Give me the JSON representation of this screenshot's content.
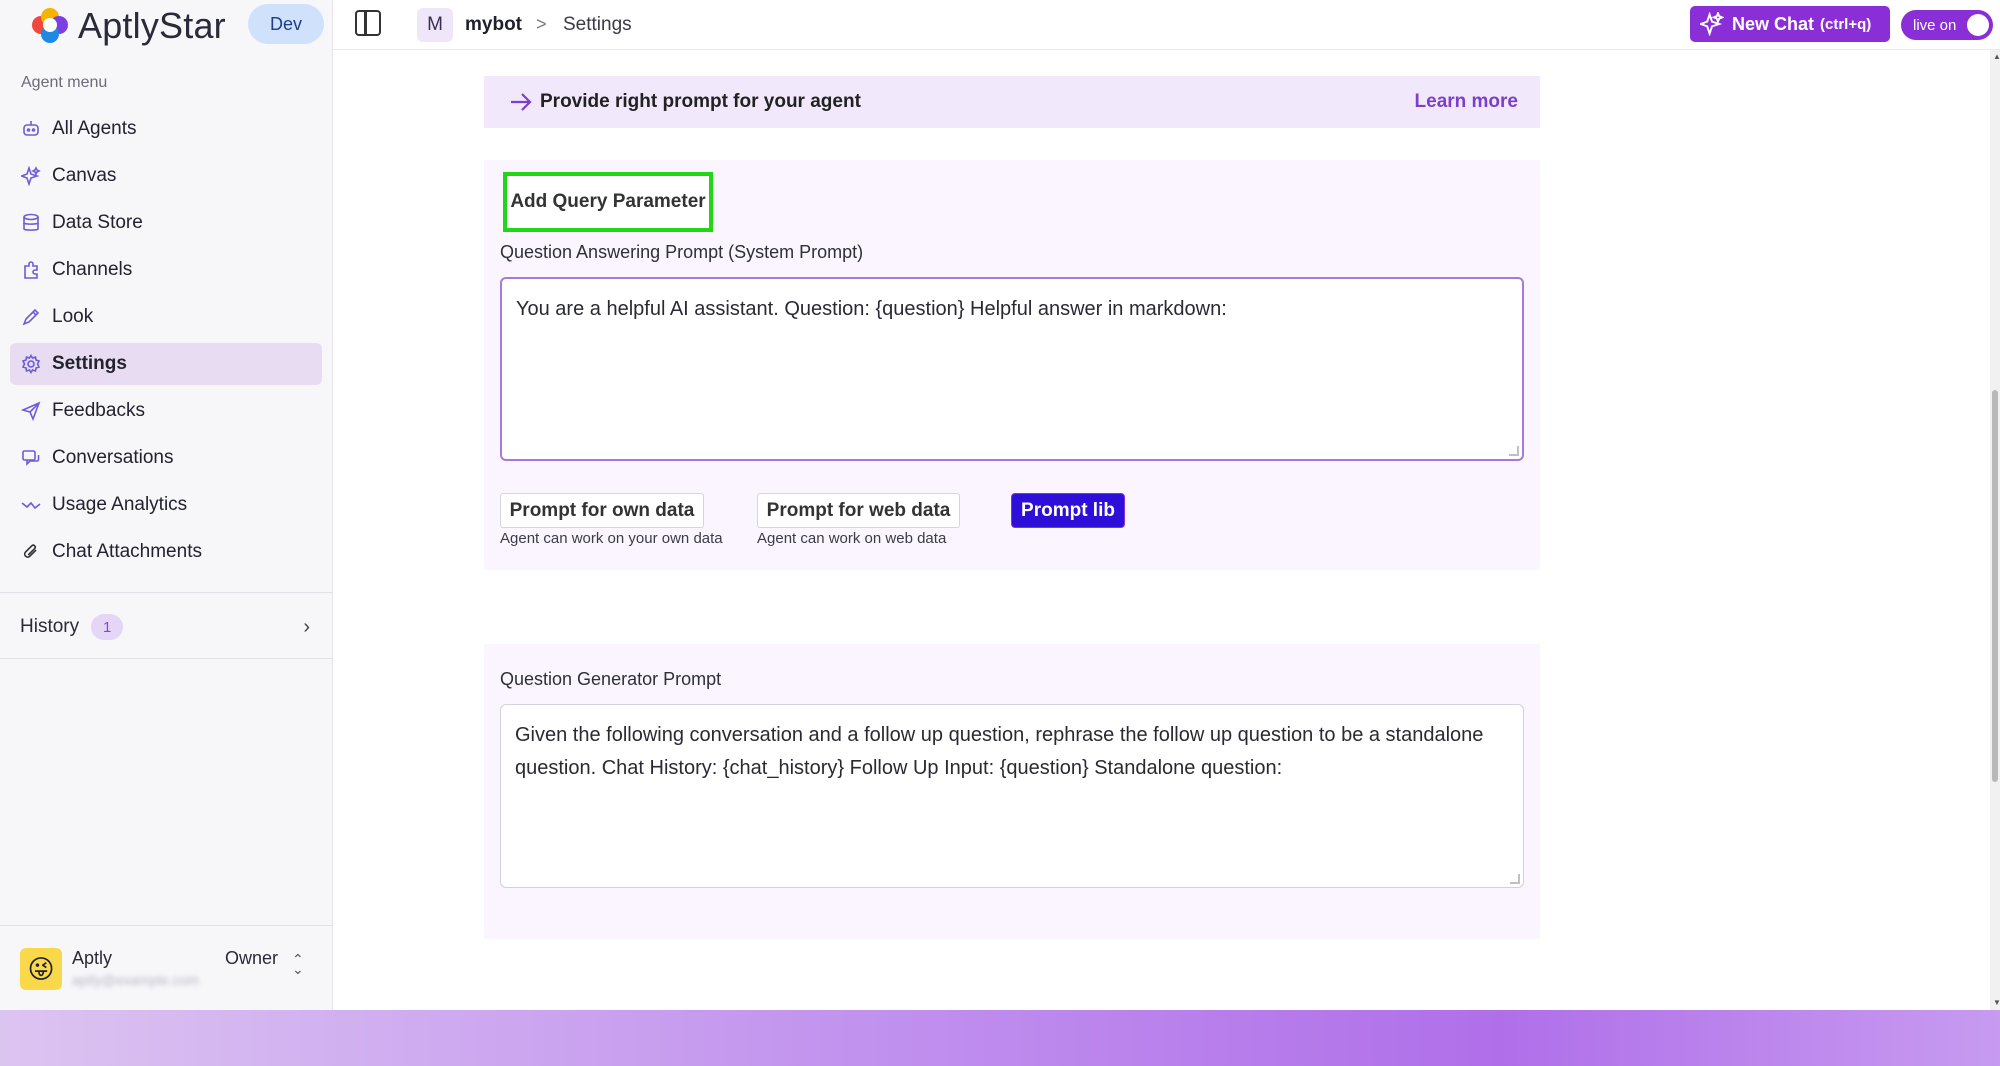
{
  "brand": {
    "name": "AptlyStar",
    "env": "Dev"
  },
  "sidebar": {
    "section_label": "Agent menu",
    "items": [
      {
        "label": "All Agents",
        "icon": "bot-icon"
      },
      {
        "label": "Canvas",
        "icon": "sparkle-icon"
      },
      {
        "label": "Data Store",
        "icon": "database-icon"
      },
      {
        "label": "Channels",
        "icon": "puzzle-icon"
      },
      {
        "label": "Look",
        "icon": "pen-icon"
      },
      {
        "label": "Settings",
        "icon": "gear-icon",
        "active": true
      },
      {
        "label": "Feedbacks",
        "icon": "send-icon"
      },
      {
        "label": "Conversations",
        "icon": "chat-icon"
      },
      {
        "label": "Usage Analytics",
        "icon": "trend-icon"
      },
      {
        "label": "Chat Attachments",
        "icon": "paperclip-icon"
      }
    ],
    "history": {
      "label": "History",
      "count": "1"
    },
    "user": {
      "name": "Aptly",
      "role": "Owner",
      "email": "aptly@example.com"
    }
  },
  "topbar": {
    "bot_initial": "M",
    "bot_name": "mybot",
    "separator": ">",
    "page": "Settings",
    "new_chat_label": "New Chat",
    "new_chat_shortcut": "(ctrl+q)",
    "live_label": "live on"
  },
  "banner": {
    "text": "Provide right prompt for your agent",
    "link": "Learn more"
  },
  "qa": {
    "add_param_label": "Add Query Parameter",
    "label": "Question Answering Prompt (System Prompt)",
    "value": "You are a helpful AI assistant.  Question: {question} Helpful answer in markdown:",
    "btn_own": "Prompt for own data",
    "note_own": "Agent can work on your own data",
    "btn_web": "Prompt for web data",
    "note_web": "Agent can work on web data",
    "btn_lib": "Prompt lib"
  },
  "qg": {
    "label": "Question Generator Prompt",
    "value": "Given the following conversation and a follow up question, rephrase the follow up question to be a standalone question.   Chat History: {chat_history} Follow Up Input: {question} Standalone question:"
  },
  "colors": {
    "accent": "#8a2fd8",
    "highlight": "#22d616",
    "prompt_lib": "#2e0fd8"
  }
}
